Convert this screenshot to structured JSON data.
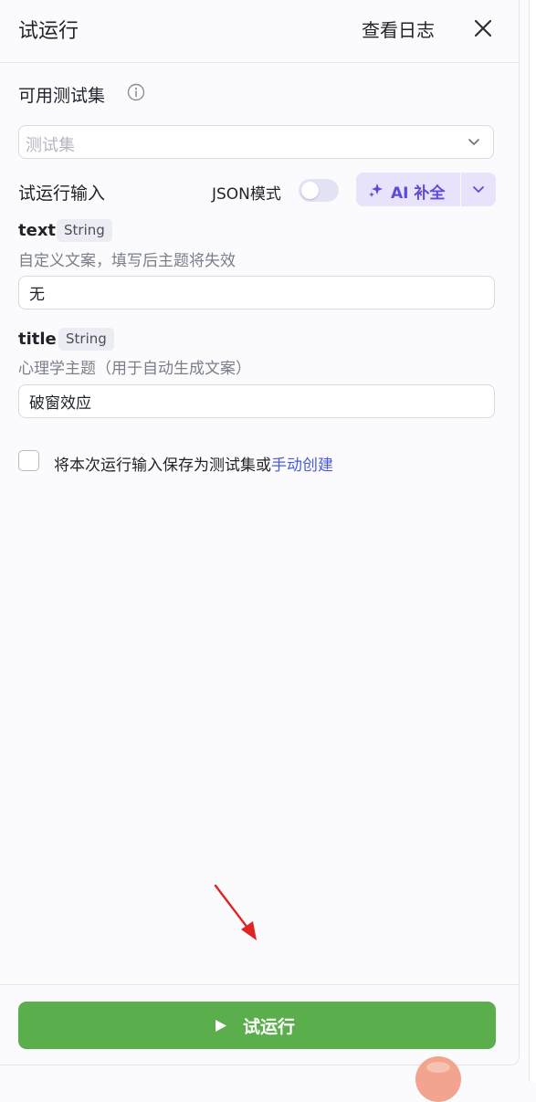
{
  "header": {
    "title": "试运行",
    "log_label": "查看日志",
    "close_icon": "close-icon"
  },
  "test_set": {
    "label": "可用测试集",
    "info_icon": "info-icon",
    "placeholder": "测试集"
  },
  "run_input": {
    "label": "试运行输入",
    "json_mode_label": "JSON模式",
    "json_mode_on": false,
    "ai_fill_label": "AI 补全",
    "ai_color": "#5b4bd6"
  },
  "fields": [
    {
      "name": "text",
      "type": "String",
      "description": "自定义文案，填写后主题将失效",
      "value": "无"
    },
    {
      "name": "title",
      "type": "String",
      "description": "心理学主题（用于自动生成文案）",
      "value": "破窗效应"
    }
  ],
  "save": {
    "text": "将本次运行输入保存为测试集或",
    "link": "手动创建",
    "checked": false
  },
  "footer": {
    "run_label": "试运行",
    "run_color": "#5aae4b"
  }
}
